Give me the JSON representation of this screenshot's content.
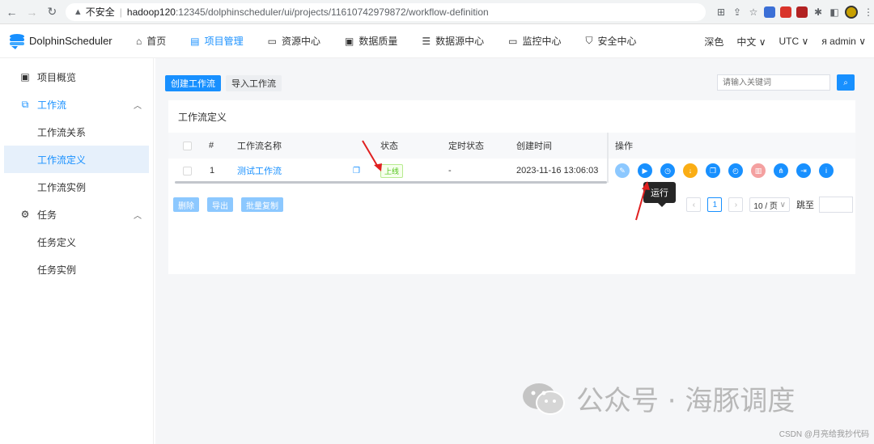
{
  "browser": {
    "security": "不安全",
    "url_host": "hadoop120",
    "url_path": ":12345/dolphinscheduler/ui/projects/11610742979872/workflow-definition"
  },
  "header": {
    "app_name": "DolphinScheduler",
    "nav": [
      {
        "label": "首页",
        "icon": "home-icon"
      },
      {
        "label": "项目管理",
        "icon": "project-icon",
        "active": true
      },
      {
        "label": "资源中心",
        "icon": "folder-icon"
      },
      {
        "label": "数据质量",
        "icon": "data-quality-icon"
      },
      {
        "label": "数据源中心",
        "icon": "database-icon"
      },
      {
        "label": "监控中心",
        "icon": "monitor-icon"
      },
      {
        "label": "安全中心",
        "icon": "shield-icon"
      }
    ],
    "theme": "深色",
    "language": "中文",
    "timezone": "UTC",
    "user": "admin"
  },
  "sidebar": {
    "items": [
      {
        "label": "项目概览",
        "icon": "overview-icon"
      },
      {
        "label": "工作流",
        "icon": "workflow-icon"
      },
      {
        "label": "工作流关系"
      },
      {
        "label": "工作流定义"
      },
      {
        "label": "工作流实例"
      },
      {
        "label": "任务",
        "icon": "gear-icon"
      },
      {
        "label": "任务定义"
      },
      {
        "label": "任务实例"
      }
    ]
  },
  "toolbar": {
    "create_label": "创建工作流",
    "import_label": "导入工作流",
    "search_placeholder": "请输入关键词"
  },
  "card": {
    "title": "工作流定义",
    "columns": [
      "#",
      "工作流名称",
      "状态",
      "定时状态",
      "创建时间",
      "操作"
    ],
    "rows": [
      {
        "index": "1",
        "name": "测试工作流",
        "status": "上线",
        "schedule_status": "-",
        "created": "2023-11-16 13:06:03"
      }
    ],
    "tooltip": "运行",
    "bottom": {
      "delete_label": "删除",
      "export_label": "导出",
      "batch_copy_label": "批量复制"
    },
    "pager": {
      "current_page": "1",
      "page_size": "10 / 页",
      "jump_label": "跳至"
    }
  },
  "watermark": {
    "text": "公众号 · 海豚调度",
    "credit": "CSDN @月亮给我抄代码"
  },
  "colors": {
    "primary": "#1890ff",
    "success": "#52c41a",
    "warning": "#faad14",
    "annotation": "#e02020"
  }
}
